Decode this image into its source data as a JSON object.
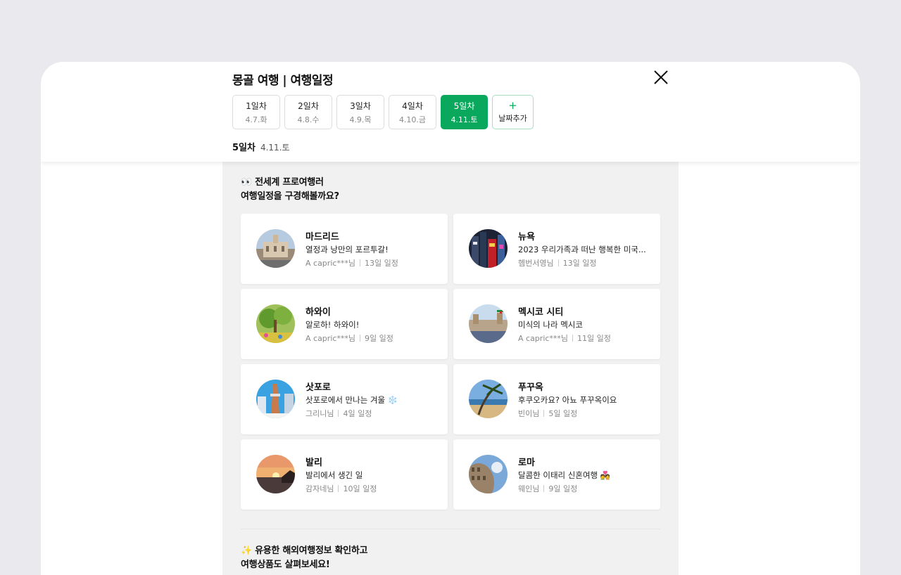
{
  "header": {
    "title": "몽골 여행 | 여행일정",
    "days": [
      {
        "label": "1일차",
        "date": "4.7.화",
        "active": false
      },
      {
        "label": "2일차",
        "date": "4.8.수",
        "active": false
      },
      {
        "label": "3일차",
        "date": "4.9.목",
        "active": false
      },
      {
        "label": "4일차",
        "date": "4.10.금",
        "active": false
      },
      {
        "label": "5일차",
        "date": "4.11.토",
        "active": true
      }
    ],
    "add_day": {
      "icon": "+",
      "label": "날짜추가"
    },
    "current": {
      "day": "5일차",
      "date": "4.11.토"
    }
  },
  "pro_section": {
    "title_line1": "👀 전세계 프로여행러",
    "title_line2": "여행일정을 구경해볼까요?"
  },
  "cards": [
    {
      "title": "마드리드",
      "desc": "열정과 낭만의 포르투갈!",
      "author": "A capric***님",
      "duration": "13일 일정",
      "thumb": "madrid"
    },
    {
      "title": "뉴욕",
      "desc": "2023 우리가족과 떠난 행복한 미국...",
      "author": "헴번서영님",
      "duration": "13일 일정",
      "thumb": "newyork"
    },
    {
      "title": "하와이",
      "desc": "알로하! 하와이!",
      "author": "A capric***님",
      "duration": "9일 일정",
      "thumb": "hawaii"
    },
    {
      "title": "멕시코 시티",
      "desc": "미식의 나라 멕시코",
      "author": "A capric***님",
      "duration": "11일 일정",
      "thumb": "mexico"
    },
    {
      "title": "삿포로",
      "desc": "삿포로에서 만나는 겨울 ❄️",
      "author": "그리니님",
      "duration": "4일 일정",
      "thumb": "sapporo"
    },
    {
      "title": "푸꾸옥",
      "desc": "후쿠오카요? 아뇨 푸꾸옥이요",
      "author": "빈이님",
      "duration": "5일 일정",
      "thumb": "phuquoc"
    },
    {
      "title": "발리",
      "desc": "발리에서 생긴 일",
      "author": "감자네님",
      "duration": "10일 일정",
      "thumb": "bali"
    },
    {
      "title": "로마",
      "desc": "달콤한 이태리 신혼여행 💑",
      "author": "웨인님",
      "duration": "9일 일정",
      "thumb": "rome"
    }
  ],
  "info_section": {
    "title_line1": "✨ 유용한 해외여행정보 확인하고",
    "title_line2": "여행상품도 살펴보세요!"
  },
  "colors": {
    "accent": "#0aa85d",
    "background": "#eaeaee",
    "content_bg": "#f1f1f1"
  }
}
